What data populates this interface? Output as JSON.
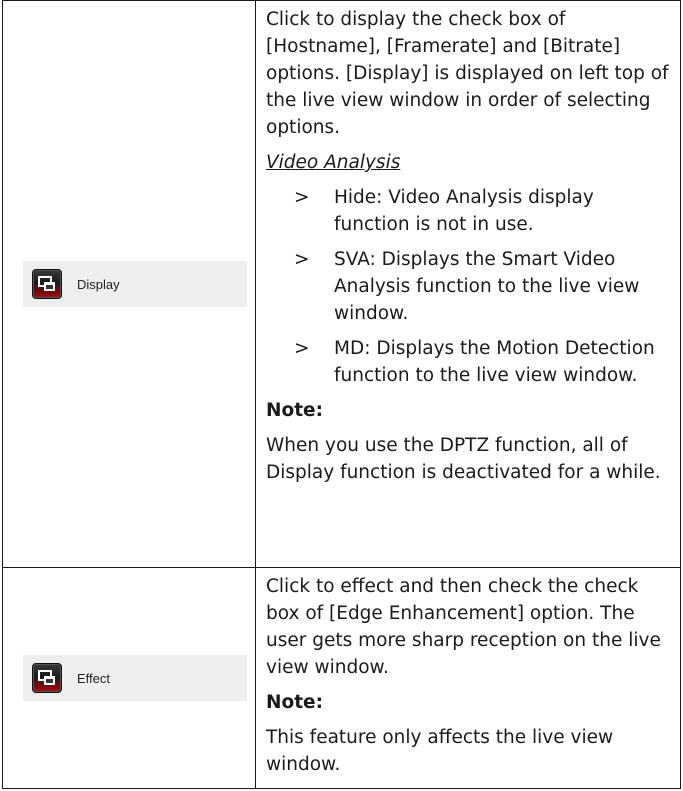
{
  "rows": [
    {
      "button_label": "Display",
      "description": "Click to display the check box of [Hostname], [Framerate] and [Bitrate] options. [Display] is displayed on left top of the live view window in order of selecting options.",
      "subheading": "Video Analysis",
      "bullets": [
        "Hide: Video Analysis display function is not in use.",
        "SVA: Displays the Smart Video Analysis function to the live view window.",
        "MD: Displays the Motion Detection function to the live view window."
      ],
      "note_label": "Note:",
      "note_text": "When you use the DPTZ function, all of Display function is deactivated for a while."
    },
    {
      "button_label": "Effect",
      "description": "Click to effect and then check the check box of [Edge Enhancement] option. The user gets more sharp reception on the live view window.",
      "note_label": "Note:",
      "note_text": "This feature only affects the live view window."
    }
  ],
  "bullet_marker": ">",
  "icon": "display-window-icon",
  "colors": {
    "icon_red": "#a51414",
    "button_bg": "#eeeeee"
  }
}
